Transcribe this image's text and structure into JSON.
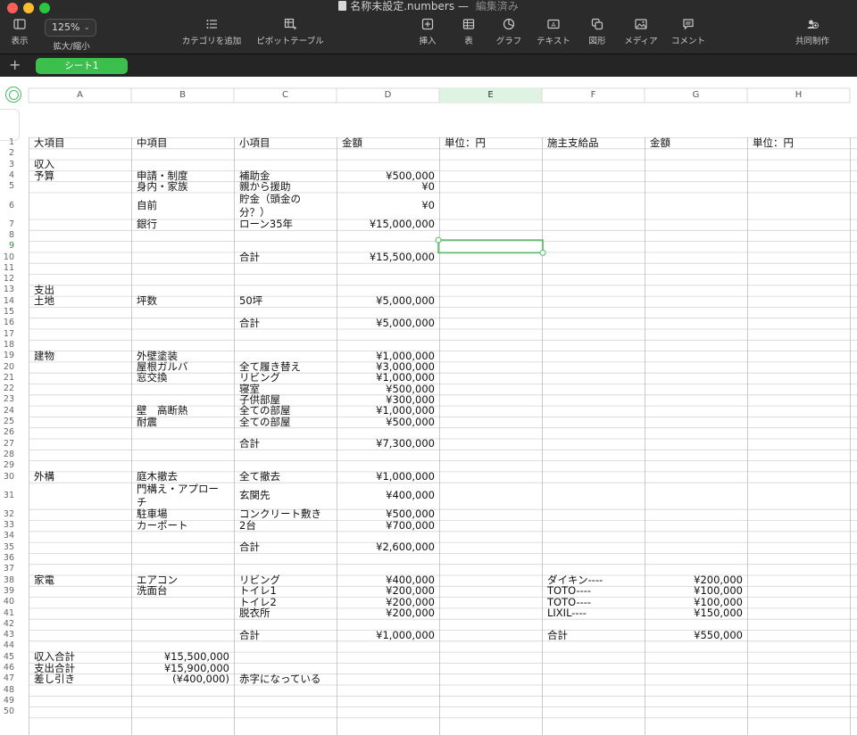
{
  "window": {
    "filename": "名称未設定.numbers",
    "separator": "—",
    "status": "編集済み"
  },
  "toolbar": {
    "view_label": "表示",
    "zoom_value": "125%",
    "zoom_label": "拡大/縮小",
    "add_category_label": "カテゴリを追加",
    "pivot_label": "ピボットテーブル",
    "insert_label": "挿入",
    "table_label": "表",
    "chart_label": "グラフ",
    "text_label": "テキスト",
    "shape_label": "図形",
    "media_label": "メディア",
    "comment_label": "コメント",
    "collaborate_label": "共同制作"
  },
  "sheet_tabs": {
    "add_label": "+",
    "active_tab": "シート1"
  },
  "spreadsheet": {
    "columns": [
      "A",
      "B",
      "C",
      "D",
      "E",
      "F",
      "G",
      "H"
    ],
    "selected_column": "E",
    "selected_row": 9,
    "row_numbers": [
      1,
      2,
      3,
      4,
      5,
      6,
      7,
      8,
      9,
      10,
      11,
      12,
      13,
      14,
      15,
      16,
      17,
      18,
      19,
      20,
      21,
      22,
      23,
      24,
      25,
      26,
      27,
      28,
      29,
      30,
      31,
      32,
      33,
      34,
      35,
      36,
      37,
      38,
      39,
      40,
      41,
      42,
      43,
      44,
      45,
      46,
      47,
      48,
      49,
      50
    ],
    "cells": [
      {
        "row": 1,
        "col": "A",
        "value": "大項目"
      },
      {
        "row": 1,
        "col": "B",
        "value": "中項目"
      },
      {
        "row": 1,
        "col": "C",
        "value": "小項目"
      },
      {
        "row": 1,
        "col": "D",
        "value": "金額"
      },
      {
        "row": 1,
        "col": "E",
        "value": "単位：円"
      },
      {
        "row": 1,
        "col": "F",
        "value": "施主支給品"
      },
      {
        "row": 1,
        "col": "G",
        "value": "金額"
      },
      {
        "row": 1,
        "col": "H",
        "value": "単位：円"
      },
      {
        "row": 3,
        "col": "A",
        "value": "収入"
      },
      {
        "row": 4,
        "col": "A",
        "value": "予算"
      },
      {
        "row": 4,
        "col": "B",
        "value": "申請・制度"
      },
      {
        "row": 4,
        "col": "C",
        "value": "補助金"
      },
      {
        "row": 4,
        "col": "D",
        "value": "¥500,000",
        "num": true
      },
      {
        "row": 5,
        "col": "B",
        "value": "身内・家族"
      },
      {
        "row": 5,
        "col": "C",
        "value": "親から援助"
      },
      {
        "row": 5,
        "col": "D",
        "value": "¥0",
        "num": true
      },
      {
        "row": 6,
        "col": "B",
        "value": "自前"
      },
      {
        "row": 6,
        "col": "C",
        "value": "貯金（頭金の"
      },
      {
        "row": 6,
        "col": "C2",
        "value": "分？）"
      },
      {
        "row": 6,
        "col": "D",
        "value": "¥0",
        "num": true
      },
      {
        "row": 7,
        "col": "B",
        "value": "銀行"
      },
      {
        "row": 7,
        "col": "C",
        "value": "ローン35年"
      },
      {
        "row": 7,
        "col": "D",
        "value": "¥15,000,000",
        "num": true
      },
      {
        "row": 10,
        "col": "C",
        "value": "合計"
      },
      {
        "row": 10,
        "col": "D",
        "value": "¥15,500,000",
        "num": true
      },
      {
        "row": 13,
        "col": "A",
        "value": "支出"
      },
      {
        "row": 14,
        "col": "A",
        "value": "土地"
      },
      {
        "row": 14,
        "col": "B",
        "value": "坪数"
      },
      {
        "row": 14,
        "col": "C",
        "value": "50坪"
      },
      {
        "row": 14,
        "col": "D",
        "value": "¥5,000,000",
        "num": true
      },
      {
        "row": 16,
        "col": "C",
        "value": "合計"
      },
      {
        "row": 16,
        "col": "D",
        "value": "¥5,000,000",
        "num": true
      },
      {
        "row": 19,
        "col": "A",
        "value": "建物"
      },
      {
        "row": 19,
        "col": "B",
        "value": "外壁塗装"
      },
      {
        "row": 19,
        "col": "D",
        "value": "¥1,000,000",
        "num": true
      },
      {
        "row": 20,
        "col": "B",
        "value": "屋根ガルバ"
      },
      {
        "row": 20,
        "col": "C",
        "value": "全て履き替え"
      },
      {
        "row": 20,
        "col": "D",
        "value": "¥3,000,000",
        "num": true
      },
      {
        "row": 21,
        "col": "B",
        "value": "窓交換"
      },
      {
        "row": 21,
        "col": "C",
        "value": "リビング"
      },
      {
        "row": 21,
        "col": "D",
        "value": "¥1,000,000",
        "num": true
      },
      {
        "row": 22,
        "col": "C",
        "value": "寝室"
      },
      {
        "row": 22,
        "col": "D",
        "value": "¥500,000",
        "num": true
      },
      {
        "row": 23,
        "col": "C",
        "value": "子供部屋"
      },
      {
        "row": 23,
        "col": "D",
        "value": "¥300,000",
        "num": true
      },
      {
        "row": 24,
        "col": "B",
        "value": "壁　高断熱"
      },
      {
        "row": 24,
        "col": "C",
        "value": "全ての部屋"
      },
      {
        "row": 24,
        "col": "D",
        "value": "¥1,000,000",
        "num": true
      },
      {
        "row": 25,
        "col": "B",
        "value": "耐震"
      },
      {
        "row": 25,
        "col": "C",
        "value": "全ての部屋"
      },
      {
        "row": 25,
        "col": "D",
        "value": "¥500,000",
        "num": true
      },
      {
        "row": 27,
        "col": "C",
        "value": "合計"
      },
      {
        "row": 27,
        "col": "D",
        "value": "¥7,300,000",
        "num": true
      },
      {
        "row": 30,
        "col": "A",
        "value": "外構"
      },
      {
        "row": 30,
        "col": "B",
        "value": "庭木撤去"
      },
      {
        "row": 30,
        "col": "C",
        "value": "全て撤去"
      },
      {
        "row": 30,
        "col": "D",
        "value": "¥1,000,000",
        "num": true
      },
      {
        "row": 31,
        "col": "B",
        "value": "門構え・アプロー"
      },
      {
        "row": 31,
        "col": "B2",
        "value": "チ"
      },
      {
        "row": 31,
        "col": "C",
        "value": "玄関先"
      },
      {
        "row": 31,
        "col": "D",
        "value": "¥400,000",
        "num": true
      },
      {
        "row": 32,
        "col": "B",
        "value": "駐車場"
      },
      {
        "row": 32,
        "col": "C",
        "value": "コンクリート敷き"
      },
      {
        "row": 32,
        "col": "D",
        "value": "¥500,000",
        "num": true
      },
      {
        "row": 33,
        "col": "B",
        "value": "カーポート"
      },
      {
        "row": 33,
        "col": "C",
        "value": "2台"
      },
      {
        "row": 33,
        "col": "D",
        "value": "¥700,000",
        "num": true
      },
      {
        "row": 35,
        "col": "C",
        "value": "合計"
      },
      {
        "row": 35,
        "col": "D",
        "value": "¥2,600,000",
        "num": true
      },
      {
        "row": 38,
        "col": "A",
        "value": "家電"
      },
      {
        "row": 38,
        "col": "B",
        "value": "エアコン"
      },
      {
        "row": 38,
        "col": "C",
        "value": "リビング"
      },
      {
        "row": 38,
        "col": "D",
        "value": "¥400,000",
        "num": true
      },
      {
        "row": 38,
        "col": "F",
        "value": "ダイキン----"
      },
      {
        "row": 38,
        "col": "G",
        "value": "¥200,000",
        "num": true
      },
      {
        "row": 39,
        "col": "B",
        "value": "洗面台"
      },
      {
        "row": 39,
        "col": "C",
        "value": "トイレ1"
      },
      {
        "row": 39,
        "col": "D",
        "value": "¥200,000",
        "num": true
      },
      {
        "row": 39,
        "col": "F",
        "value": "TOTO----"
      },
      {
        "row": 39,
        "col": "G",
        "value": "¥100,000",
        "num": true
      },
      {
        "row": 40,
        "col": "C",
        "value": "トイレ2"
      },
      {
        "row": 40,
        "col": "D",
        "value": "¥200,000",
        "num": true
      },
      {
        "row": 40,
        "col": "F",
        "value": "TOTO----"
      },
      {
        "row": 40,
        "col": "G",
        "value": "¥100,000",
        "num": true
      },
      {
        "row": 41,
        "col": "C",
        "value": "脱衣所"
      },
      {
        "row": 41,
        "col": "D",
        "value": "¥200,000",
        "num": true
      },
      {
        "row": 41,
        "col": "F",
        "value": "LIXIL----"
      },
      {
        "row": 41,
        "col": "G",
        "value": "¥150,000",
        "num": true
      },
      {
        "row": 43,
        "col": "C",
        "value": "合計"
      },
      {
        "row": 43,
        "col": "D",
        "value": "¥1,000,000",
        "num": true
      },
      {
        "row": 43,
        "col": "F",
        "value": "合計"
      },
      {
        "row": 43,
        "col": "G",
        "value": "¥550,000",
        "num": true
      },
      {
        "row": 45,
        "col": "A",
        "value": "収入合計"
      },
      {
        "row": 45,
        "col": "B",
        "value": "¥15,500,000",
        "num": true
      },
      {
        "row": 46,
        "col": "A",
        "value": "支出合計"
      },
      {
        "row": 46,
        "col": "B",
        "value": "¥15,900,000",
        "num": true
      },
      {
        "row": 47,
        "col": "A",
        "value": "差し引き"
      },
      {
        "row": 47,
        "col": "B",
        "value": "(¥400,000)",
        "num": true
      },
      {
        "row": 47,
        "col": "C",
        "value": "赤字になっている"
      }
    ]
  },
  "colors": {
    "titlebar": "#2b2b2b",
    "tab_active": "#3cbf4c",
    "selection": "#5ab86b",
    "selected_header": "#dff3e2",
    "grid": "#d4d4d4"
  }
}
